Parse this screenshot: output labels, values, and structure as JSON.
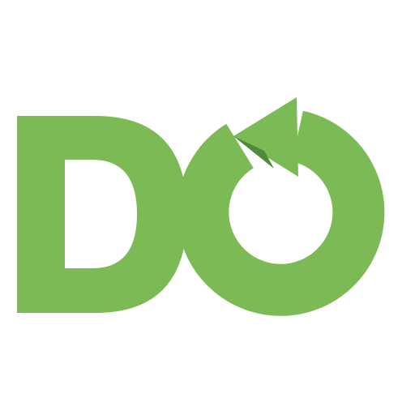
{
  "logo": {
    "text": "DO",
    "colors": {
      "background": "#ffffff",
      "primary": "#7cba55",
      "shade": "#4e8a3c"
    },
    "icon": "refresh-arrow-icon"
  }
}
